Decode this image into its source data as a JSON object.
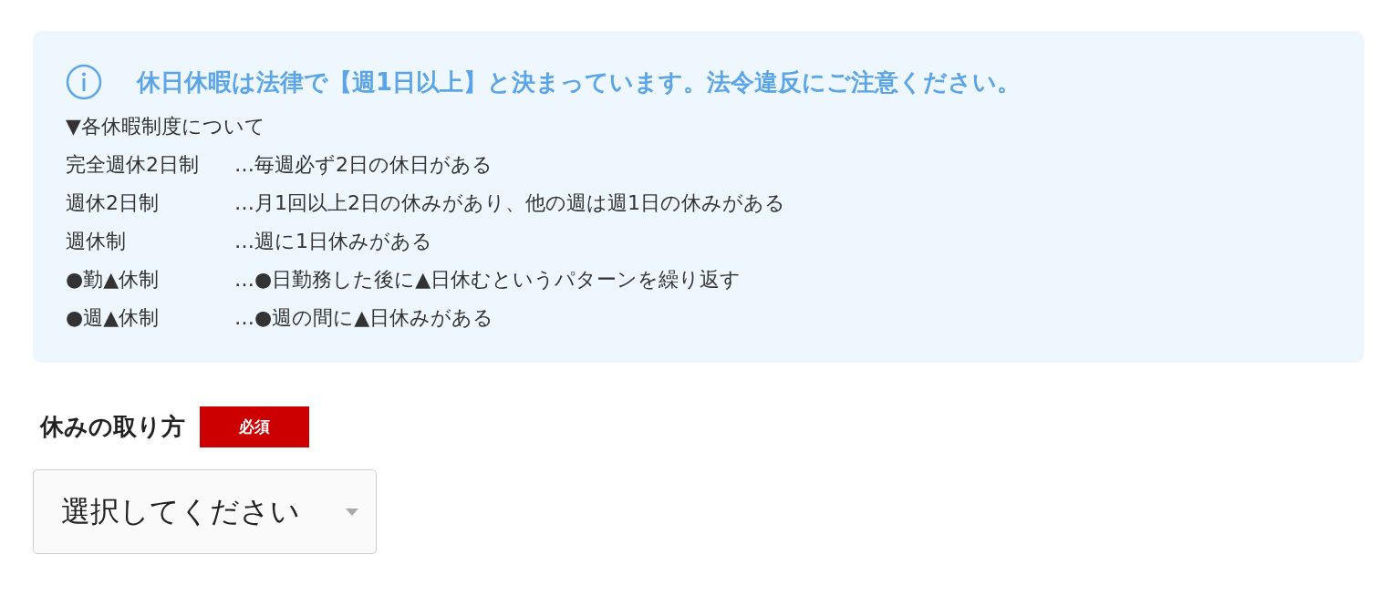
{
  "notice": {
    "heading": "休日休暇は法律で【週1日以上】と決まっています。法令違反にご注意ください。",
    "subheading": "▼各休暇制度について",
    "systems": [
      {
        "term": "完全週休2日制",
        "description": "…毎週必ず2日の休日がある"
      },
      {
        "term": "週休2日制",
        "description": "…月1回以上2日の休みがあり、他の週は週1日の休みがある"
      },
      {
        "term": "週休制",
        "description": "…週に1日休みがある"
      },
      {
        "term": "●勤▲休制",
        "description": "…●日勤務した後に▲日休むというパターンを繰り返す"
      },
      {
        "term": "●週▲休制",
        "description": "…●週の間に▲日休みがある"
      }
    ]
  },
  "field": {
    "label": "休みの取り方",
    "required": true,
    "required_badge": "必須",
    "select": {
      "value": "選択してください"
    }
  }
}
